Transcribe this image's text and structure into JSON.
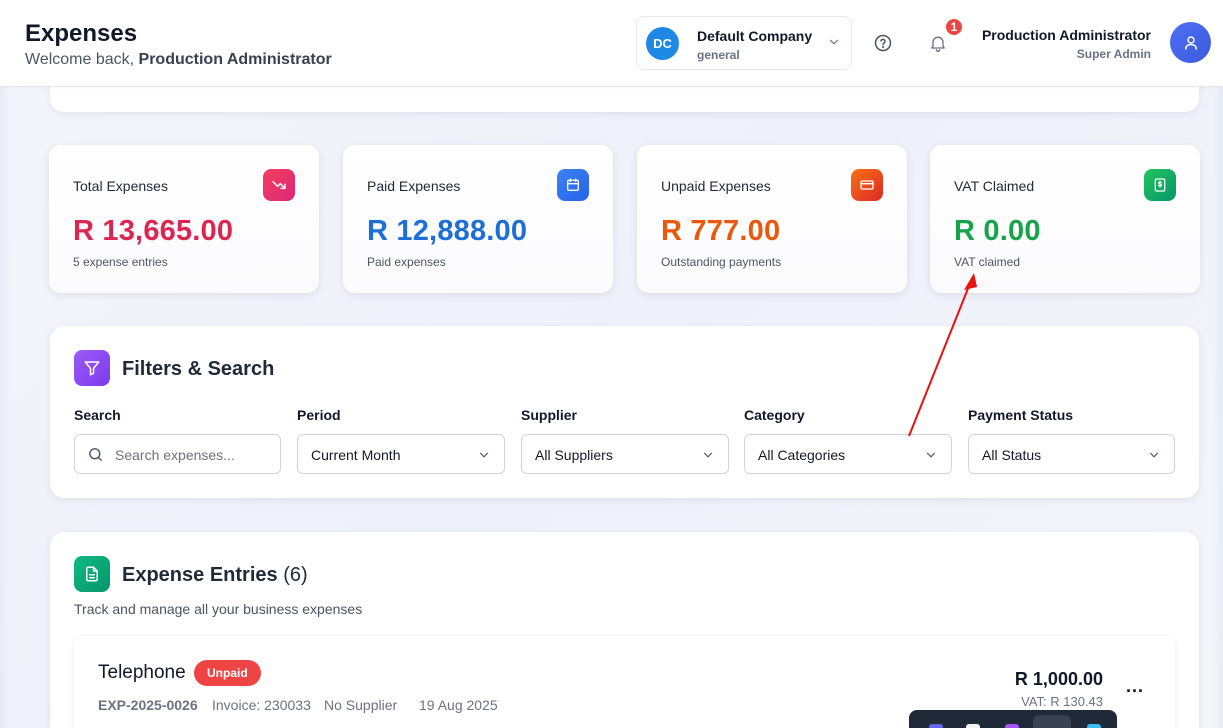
{
  "header": {
    "title": "Expenses",
    "welcome_prefix": "Welcome back, ",
    "welcome_user": "Production Administrator"
  },
  "company": {
    "initials": "DC",
    "name": "Default Company",
    "sub": "general",
    "avatar_color": "#1e88e5"
  },
  "notifications": {
    "count": "1"
  },
  "user": {
    "name": "Production Administrator",
    "role": "Super Admin"
  },
  "stats": [
    {
      "title": "Total Expenses",
      "value": "R 13,665.00",
      "sub": "5 expense entries",
      "color": "#dc2651",
      "icon": "trending-down-icon"
    },
    {
      "title": "Paid Expenses",
      "value": "R 12,888.00",
      "sub": "Paid expenses",
      "color": "#1d6fd6",
      "icon": "calendar-icon"
    },
    {
      "title": "Unpaid Expenses",
      "value": "R 777.00",
      "sub": "Outstanding payments",
      "color": "#ea580c",
      "icon": "credit-card-icon"
    },
    {
      "title": "VAT Claimed",
      "value": "R 0.00",
      "sub": "VAT claimed",
      "color": "#16a34a",
      "icon": "receipt-dollar-icon"
    }
  ],
  "filters": {
    "title": "Filters & Search",
    "search": {
      "label": "Search",
      "placeholder": "Search expenses..."
    },
    "period": {
      "label": "Period",
      "value": "Current Month"
    },
    "supplier": {
      "label": "Supplier",
      "value": "All Suppliers"
    },
    "category": {
      "label": "Category",
      "value": "All Categories"
    },
    "payment_status": {
      "label": "Payment Status",
      "value": "All Status"
    }
  },
  "entries": {
    "title": "Expense Entries",
    "count": "(6)",
    "subtitle": "Track and manage all your business expenses",
    "items": [
      {
        "name": "Telephone",
        "status": "Unpaid",
        "id": "EXP-2025-0026",
        "invoice": "Invoice: 230033",
        "supplier": "No Supplier",
        "date": "19 Aug 2025",
        "amount": "R 1,000.00",
        "vat": "VAT: R 130.43",
        "more": "..."
      }
    ]
  },
  "colors": {
    "accent_purple": "#7c3aed",
    "accent_green": "#10b981",
    "danger": "#ef4444",
    "annotation_arrow": "#e81010"
  }
}
